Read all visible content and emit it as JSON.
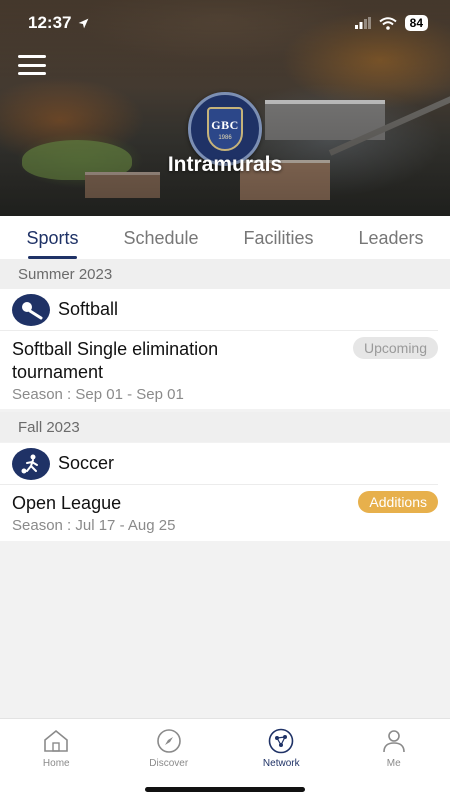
{
  "status": {
    "time": "12:37",
    "battery": "84"
  },
  "header": {
    "title": "Intramurals",
    "crest_text": "GBC",
    "crest_year": "1986"
  },
  "tabs": [
    {
      "label": "Sports",
      "active": true
    },
    {
      "label": "Schedule",
      "active": false
    },
    {
      "label": "Facilities",
      "active": false
    },
    {
      "label": "Leaders",
      "active": false
    }
  ],
  "sections": [
    {
      "season": "Summer 2023",
      "sport": {
        "name": "Softball",
        "icon": "softball-icon"
      },
      "event": {
        "title": "Softball Single elimination tournament",
        "dates": "Season : Sep 01 - Sep 01",
        "badge": "Upcoming"
      }
    },
    {
      "season": "Fall 2023",
      "sport": {
        "name": "Soccer",
        "icon": "soccer-icon"
      },
      "event": {
        "title": "Open League",
        "dates": "Season : Jul 17 - Aug 25",
        "badge": "Additions"
      }
    }
  ],
  "bottom_nav": [
    {
      "label": "Home",
      "icon": "home-icon"
    },
    {
      "label": "Discover",
      "icon": "compass-icon"
    },
    {
      "label": "Network",
      "icon": "network-icon",
      "active": true
    },
    {
      "label": "Me",
      "icon": "person-icon"
    }
  ],
  "colors": {
    "primary": "#1f3266",
    "additions_badge": "#e7b04c",
    "upcoming_badge": "#e6e6e6"
  }
}
